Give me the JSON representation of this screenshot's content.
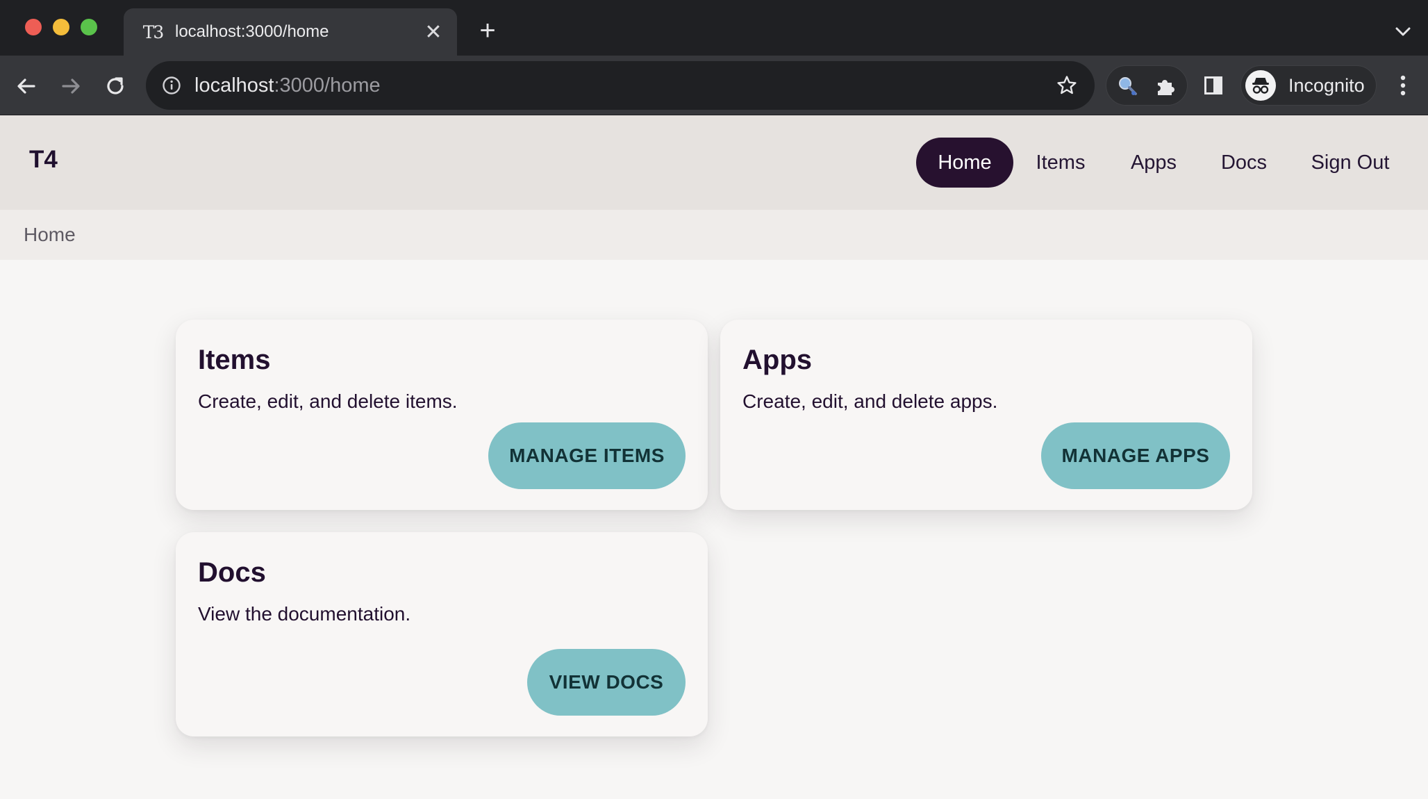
{
  "browser": {
    "tab": {
      "favicon_glyph": "T3",
      "title": "localhost:3000/home",
      "close_glyph": "✕"
    },
    "new_tab_glyph": "+",
    "address": {
      "host": "localhost",
      "path": ":3000/home"
    },
    "profile_label": "Incognito"
  },
  "app": {
    "logo": "T4",
    "nav": [
      {
        "label": "Home",
        "active": true
      },
      {
        "label": "Items"
      },
      {
        "label": "Apps"
      },
      {
        "label": "Docs"
      },
      {
        "label": "Sign Out"
      }
    ],
    "breadcrumb": "Home",
    "cards": [
      {
        "title": "Items",
        "description": "Create, edit, and delete items.",
        "button": "MANAGE ITEMS"
      },
      {
        "title": "Apps",
        "description": "Create, edit, and delete apps.",
        "button": "MANAGE APPS"
      },
      {
        "title": "Docs",
        "description": "View the documentation.",
        "button": "VIEW DOCS"
      }
    ]
  },
  "colors": {
    "chrome_dark": "#1f2023",
    "chrome_toolbar": "#36373b",
    "header_bg": "#e6e2df",
    "breadcrumb_bg": "#efecea",
    "page_bg": "#f7f6f5",
    "nav_active_bg": "#27112f",
    "button_bg": "#80c1c6",
    "text_dark": "#22102f"
  }
}
